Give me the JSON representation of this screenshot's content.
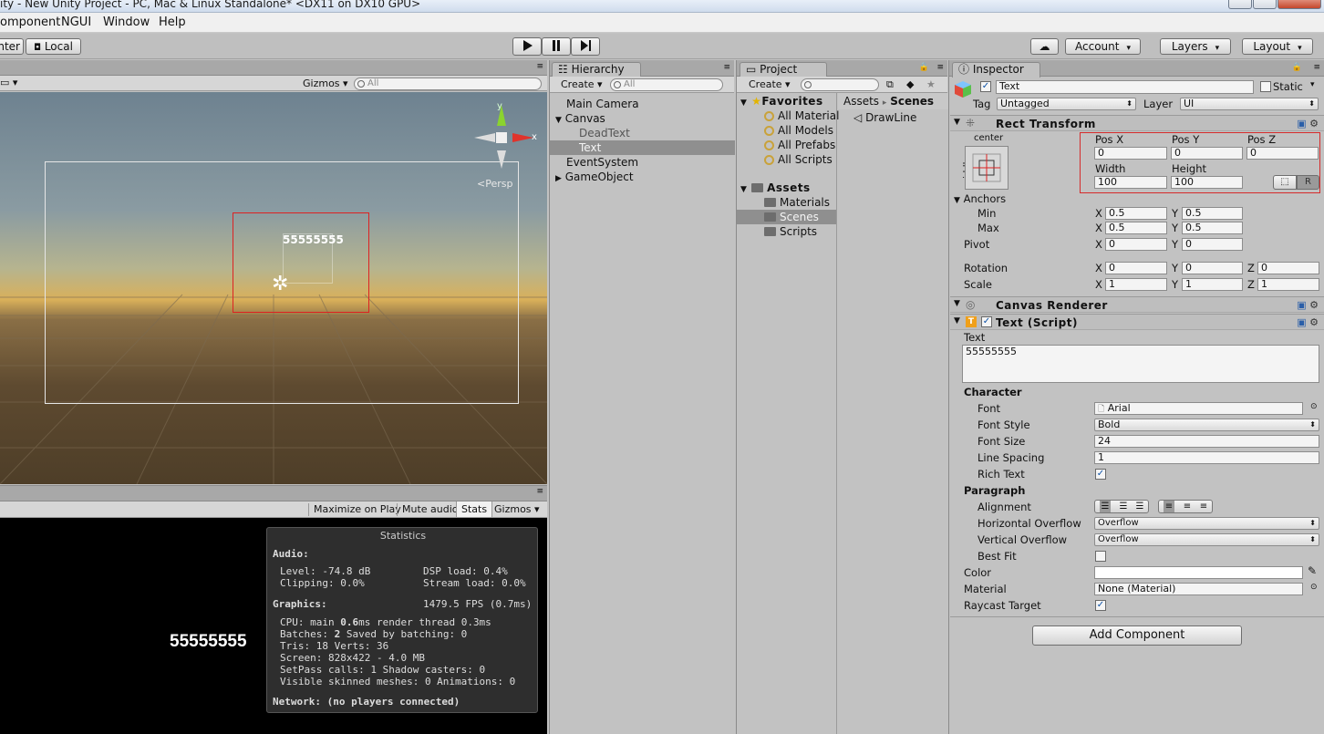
{
  "window": {
    "title": "ity - New Unity Project - PC, Mac & Linux Standalone* <DX11 on DX10 GPU>"
  },
  "menu": [
    "omponent",
    "NGUI",
    "Window",
    "Help"
  ],
  "toolbar": {
    "pivot": "nter",
    "local": "Local",
    "cloud_icon": "cloud-icon",
    "account": "Account",
    "layers": "Layers",
    "layout": "Layout"
  },
  "scene": {
    "gizmos": "Gizmos",
    "search": "All",
    "persp": "Persp",
    "axis_y": "y",
    "axis_x": "x",
    "text": "55555555"
  },
  "game": {
    "maximize": "Maximize on Play",
    "mute": "Mute audio",
    "stats": "Stats",
    "gizmos": "Gizmos",
    "text": "55555555"
  },
  "stats": {
    "title": "Statistics",
    "audio_head": "Audio:",
    "level": "Level: -74.8 dB",
    "dsp": "DSP load: 0.4%",
    "clipping": "Clipping: 0.0%",
    "stream": "Stream load: 0.0%",
    "graphics_head": "Graphics:",
    "fps": "1479.5 FPS (0.7ms)",
    "cpu_a": "CPU: main ",
    "cpu_b": "0.6",
    "cpu_c": "ms  render thread 0.3ms",
    "batches_a": "Batches: ",
    "batches_b": "2",
    "batches_c": "      Saved by batching: 0",
    "tris": "Tris: 18   Verts: 36",
    "screen": "Screen: 828x422 - 4.0 MB",
    "setpass": "SetPass calls: 1      Shadow casters: 0",
    "skinned": "Visible skinned meshes: 0  Animations: 0",
    "network": "Network: (no players connected)"
  },
  "hierarchy": {
    "tab": "Hierarchy",
    "create": "Create",
    "search": "All",
    "items": [
      "Main Camera",
      "Canvas",
      "DeadText",
      "Text",
      "EventSystem",
      "GameObject"
    ]
  },
  "project": {
    "tab": "Project",
    "create": "Create",
    "favorites": "Favorites",
    "fav_items": [
      "All Material",
      "All Models",
      "All Prefabs",
      "All Scripts"
    ],
    "assets": "Assets",
    "asset_items": [
      "Materials",
      "Scenes",
      "Scripts"
    ],
    "crumb_a": "Assets",
    "crumb_sep": "▸",
    "crumb_b": "Scenes",
    "file": "DrawLine"
  },
  "inspector": {
    "tab": "Inspector",
    "name": "Text",
    "static": "Static",
    "tag_label": "Tag",
    "tag": "Untagged",
    "layer_label": "Layer",
    "layer": "UI",
    "rect": {
      "title": "Rect Transform",
      "anchor_h": "center",
      "anchor_v": "middle",
      "posx_l": "Pos X",
      "posy_l": "Pos Y",
      "posz_l": "Pos Z",
      "posx": "0",
      "posy": "0",
      "posz": "0",
      "w_l": "Width",
      "h_l": "Height",
      "w": "100",
      "h": "100",
      "r": "R",
      "anchors": "Anchors",
      "min": "Min",
      "max": "Max",
      "pivot": "Pivot",
      "minx": "0.5",
      "miny": "0.5",
      "maxx": "0.5",
      "maxy": "0.5",
      "pivx": "0",
      "pivy": "0",
      "rotation": "Rotation",
      "rx": "0",
      "ry": "0",
      "rz": "0",
      "scale": "Scale",
      "sx": "1",
      "sy": "1",
      "sz": "1",
      "X": "X",
      "Y": "Y",
      "Z": "Z"
    },
    "canvas_renderer": "Canvas Renderer",
    "text_script": {
      "title": "Text (Script)",
      "text_l": "Text",
      "text": "55555555",
      "character": "Character",
      "font_l": "Font",
      "font": "Arial",
      "style_l": "Font Style",
      "style": "Bold",
      "size_l": "Font Size",
      "size": "24",
      "spacing_l": "Line Spacing",
      "spacing": "1",
      "rich_l": "Rich Text",
      "paragraph": "Paragraph",
      "align_l": "Alignment",
      "hov_l": "Horizontal Overflow",
      "hov": "Overflow",
      "vov_l": "Vertical Overflow",
      "vov": "Overflow",
      "best_l": "Best Fit",
      "color_l": "Color",
      "mat_l": "Material",
      "mat": "None (Material)",
      "ray_l": "Raycast Target"
    },
    "add_component": "Add Component"
  }
}
